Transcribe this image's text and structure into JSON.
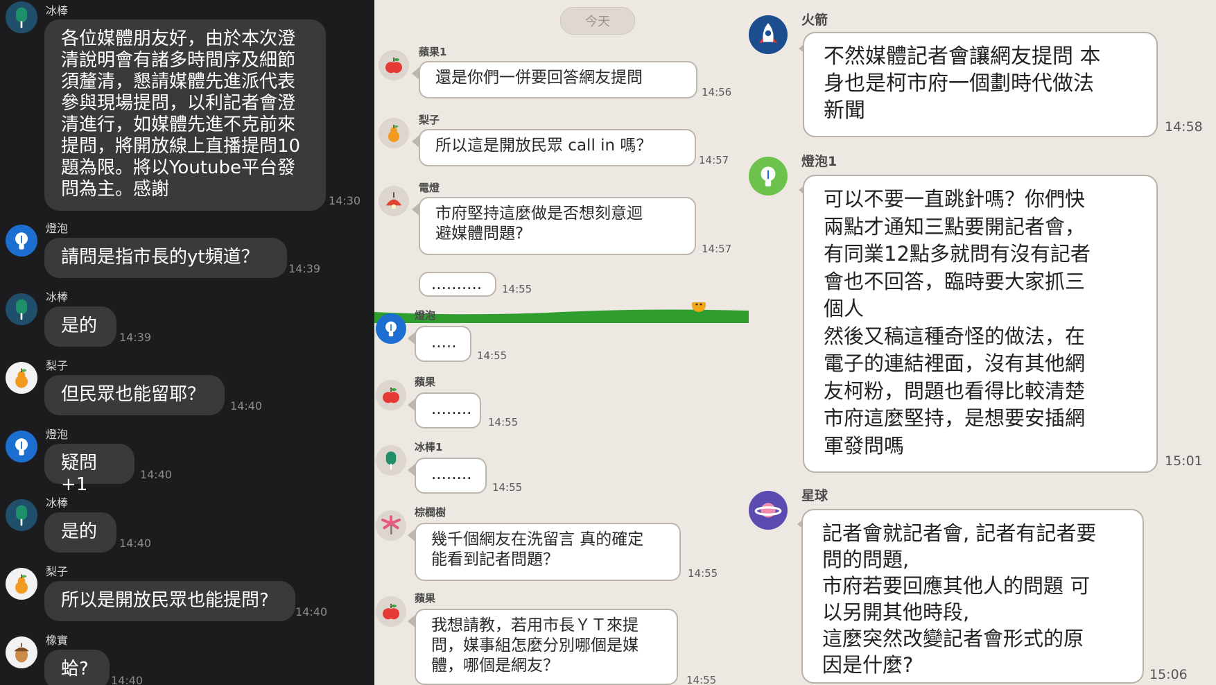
{
  "left_panel": {
    "messages": [
      {
        "sender": "冰棒",
        "avatar_icon": "popsicle-icon",
        "text": "各位媒體朋友好，由於本次澄\n清說明會有諸多時間序及細節\n須釐清，懇請媒體先進派代表\n參與現場提問，以利記者會澄\n清進行，如媒體先進不克前來\n提問，將開放線上直播提問10\n題為限。將以Youtube平台發\n問為主。感謝",
        "time": "14:30"
      },
      {
        "sender": "燈泡",
        "avatar_icon": "lightbulb-icon",
        "text": "請問是指市長的yt頻道？",
        "time": "14:39"
      },
      {
        "sender": "冰棒",
        "avatar_icon": "popsicle-icon",
        "text": "是的",
        "time": "14:39"
      },
      {
        "sender": "梨子",
        "avatar_icon": "pear-icon",
        "text": "但民眾也能留耶？",
        "time": "14:40"
      },
      {
        "sender": "燈泡",
        "avatar_icon": "lightbulb-icon",
        "text": "疑問 +1",
        "time": "14:40"
      },
      {
        "sender": "冰棒",
        "avatar_icon": "popsicle-icon",
        "text": "是的",
        "time": "14:40"
      },
      {
        "sender": "梨子",
        "avatar_icon": "pear-icon",
        "text": "所以是開放民眾也能提問?",
        "time": "14:40"
      },
      {
        "sender": "橡實",
        "avatar_icon": "acorn-icon",
        "text": "蛤?",
        "time": "14:40"
      }
    ]
  },
  "middle_panel": {
    "date_label": "今天",
    "messages": [
      {
        "sender": "蘋果1",
        "avatar_icon": "apple-icon",
        "text": "還是你們一併要回答網友提問",
        "time": "14:56"
      },
      {
        "sender": "梨子",
        "avatar_icon": "pear-icon",
        "text": "所以這是開放民眾 call in 嗎？",
        "time": "14:57"
      },
      {
        "sender": "電燈",
        "avatar_icon": "lamp-icon",
        "text": "市府堅持這麼做是否想刻意迴\n避媒體問題?",
        "time": "14:57"
      },
      {
        "sender": "",
        "avatar_icon": "",
        "text": "..........",
        "time": "14:55"
      },
      {
        "sender": "燈泡",
        "avatar_icon": "lightbulb-icon",
        "text": ".....",
        "time": "14:55"
      },
      {
        "sender": "蘋果",
        "avatar_icon": "apple-icon",
        "text": "........",
        "time": "14:55"
      },
      {
        "sender": "冰棒1",
        "avatar_icon": "popsicle-icon",
        "text": "........",
        "time": "14:55"
      },
      {
        "sender": "棕櫚樹",
        "avatar_icon": "palm-tree-icon",
        "text": "幾千個網友在洗留言 真的確定\n能看到記者問題？",
        "time": "14:55"
      },
      {
        "sender": "蘋果",
        "avatar_icon": "apple-icon",
        "text": "我想請教，若用市長ＹＴ來提\n問，媒事組怎麼分別哪個是媒\n體，哪個是網友？",
        "time": "14:55"
      }
    ]
  },
  "right_panel": {
    "messages": [
      {
        "sender": "火箭",
        "avatar_icon": "rocket-icon",
        "text": "不然媒體記者會讓網友提問 本\n身也是柯市府一個劃時代做法\n新聞",
        "time": "14:58"
      },
      {
        "sender": "燈泡1",
        "avatar_icon": "lightbulb-icon",
        "text": "可以不要一直跳針嗎？你們快\n兩點才通知三點要開記者會，\n有同業12點多就問有沒有記者\n會也不回答，臨時要大家抓三\n個人\n然後又稿這種奇怪的做法，在\n電子的連結裡面，沒有其他網\n友柯粉，問題也看得比較清楚\n市府這麼堅持，是想要安插網\n軍發問嗎",
        "time": "15:01"
      },
      {
        "sender": "星球",
        "avatar_icon": "planet-icon",
        "text": "記者會就記者會, 記者有記者要\n問的問題,\n市府若要回應其他人的問題 可\n以另開其他時段,\n這麼突然改變記者會形式的原\n因是什麼?",
        "time": "15:06"
      }
    ]
  },
  "colors": {
    "dark_bg": "#1c1c1e",
    "dark_bubble": "#3a3a3c",
    "light_bg": "#ede8e2",
    "bubble_border": "#bdb6ae",
    "grass_green": "#2f9e2f"
  }
}
